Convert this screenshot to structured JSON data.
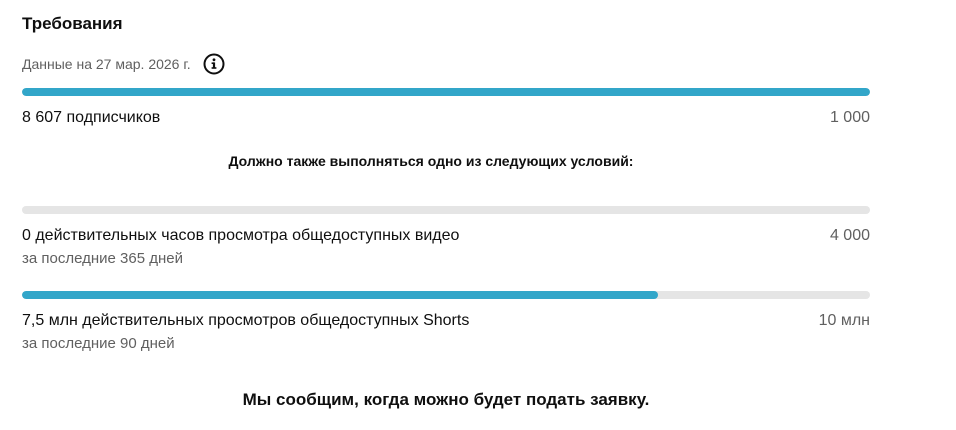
{
  "header": {
    "title": "Требования",
    "date_text": "Данные на 27 мар. 2026 г."
  },
  "requirements": {
    "subscribers": {
      "label": "8 607 подписчиков",
      "target": "1 000",
      "progress_fraction": 1.0
    },
    "condition_note": "Должно также выполняться одно из следующих условий:",
    "watch_hours": {
      "label": "0 действительных часов просмотра общедоступных видео",
      "period": "за последние 365 дней",
      "target": "4 000",
      "progress_fraction": 0.0
    },
    "shorts_views": {
      "label": "7,5 млн действительных просмотров общедоступных Shorts",
      "period": "за последние 90 дней",
      "target": "10 млн",
      "progress_fraction": 0.75
    }
  },
  "footer": {
    "note": "Мы сообщим, когда можно будет подать заявку."
  },
  "colors": {
    "progress_fill": "#32a6c9",
    "progress_track": "#e5e5e5"
  },
  "icons": {
    "info": "info-icon"
  }
}
